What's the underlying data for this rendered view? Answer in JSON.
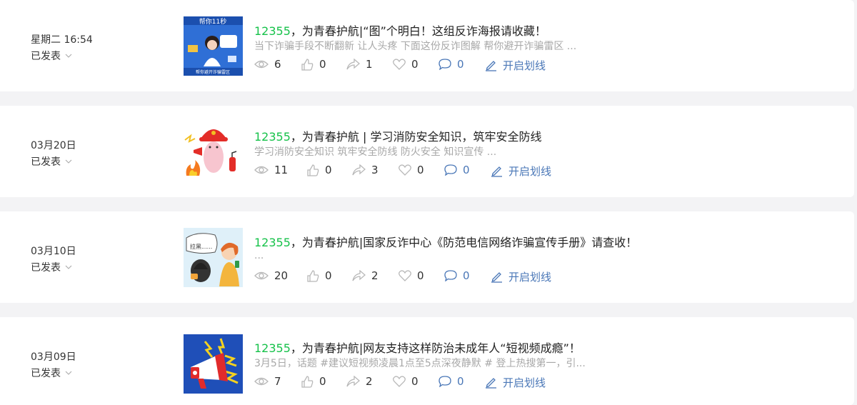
{
  "posts": [
    {
      "date": "星期二 16:54",
      "status": "已发表",
      "title_num": "12355",
      "title_rest": "，为青春护航|“图”个明白！这组反诈海报请收藏！",
      "desc": "当下诈骗手段不断翻新 让人头疼 下面这份反诈图解 帮你避开诈骗雷区 ...",
      "views": "6",
      "likes": "0",
      "shares": "1",
      "favs": "0",
      "comments": "0",
      "mark_label": "开启划线",
      "thumb_text": "帮你避开诈骗雷区"
    },
    {
      "date": "03月20日",
      "status": "已发表",
      "title_num": "12355",
      "title_rest": "，为青春护航 | 学习消防安全知识，筑牢安全防线",
      "desc": "学习消防安全知识 筑牢安全防线 防火安全 知识宣传 ...",
      "views": "11",
      "likes": "0",
      "shares": "3",
      "favs": "0",
      "comments": "0",
      "mark_label": "开启划线"
    },
    {
      "date": "03月10日",
      "status": "已发表",
      "title_num": "12355",
      "title_rest": "，为青春护航|国家反诈中心《防范电信网络诈骗宣传手册》请查收！",
      "desc": "...",
      "views": "20",
      "likes": "0",
      "shares": "2",
      "favs": "0",
      "comments": "0",
      "mark_label": "开启划线",
      "thumb_text": "拉黑......"
    },
    {
      "date": "03月09日",
      "status": "已发表",
      "title_num": "12355",
      "title_rest": "，为青春护航|网友支持这样防治未成年人“短视频成瘾”！",
      "desc": "3月5日，话题 #建议短视频凌晨1点至5点深夜静默 # 登上热搜第一，引...",
      "views": "7",
      "likes": "0",
      "shares": "2",
      "favs": "0",
      "comments": "0",
      "mark_label": "开启划线"
    }
  ],
  "colors": {
    "accent_green": "#16c24a",
    "link_blue": "#4a77b7",
    "desc_gray": "#a8a8a8"
  },
  "icons": [
    "chevron-down-icon",
    "eye-icon",
    "thumbs-up-icon",
    "share-icon",
    "heart-icon",
    "comment-icon",
    "pen-icon"
  ]
}
